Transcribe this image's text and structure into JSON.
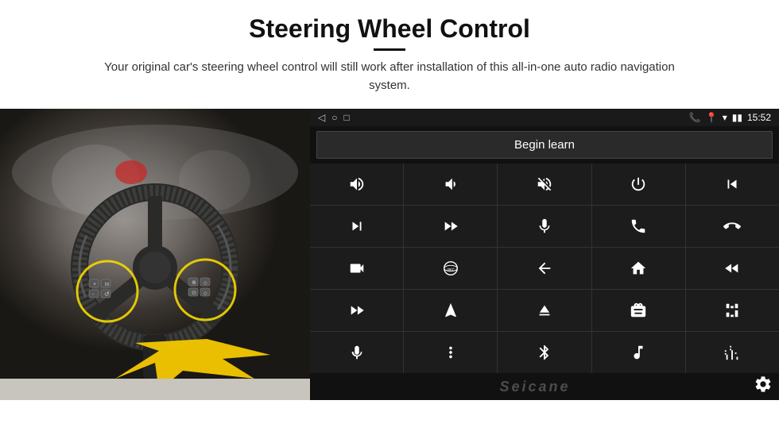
{
  "header": {
    "title": "Steering Wheel Control",
    "subtitle": "Your original car's steering wheel control will still work after installation of this all-in-one auto radio navigation system."
  },
  "statusbar": {
    "time": "15:52",
    "nav_back": "◁",
    "nav_home": "○",
    "nav_recent": "□"
  },
  "begin_learn": {
    "label": "Begin learn"
  },
  "watermark": "Seicane",
  "controls": [
    {
      "icon": "vol-up",
      "row": 0,
      "col": 0
    },
    {
      "icon": "vol-down",
      "row": 0,
      "col": 1
    },
    {
      "icon": "mute",
      "row": 0,
      "col": 2
    },
    {
      "icon": "power",
      "row": 0,
      "col": 3
    },
    {
      "icon": "prev-track",
      "row": 0,
      "col": 4
    },
    {
      "icon": "next",
      "row": 1,
      "col": 0
    },
    {
      "icon": "ff-skip",
      "row": 1,
      "col": 1
    },
    {
      "icon": "mic",
      "row": 1,
      "col": 2
    },
    {
      "icon": "phone",
      "row": 1,
      "col": 3
    },
    {
      "icon": "hangup",
      "row": 1,
      "col": 4
    },
    {
      "icon": "cam",
      "row": 2,
      "col": 0
    },
    {
      "icon": "360",
      "row": 2,
      "col": 1
    },
    {
      "icon": "back",
      "row": 2,
      "col": 2
    },
    {
      "icon": "home",
      "row": 2,
      "col": 3
    },
    {
      "icon": "rw",
      "row": 2,
      "col": 4
    },
    {
      "icon": "ff",
      "row": 3,
      "col": 0
    },
    {
      "icon": "nav",
      "row": 3,
      "col": 1
    },
    {
      "icon": "eject",
      "row": 3,
      "col": 2
    },
    {
      "icon": "radio",
      "row": 3,
      "col": 3
    },
    {
      "icon": "eq",
      "row": 3,
      "col": 4
    },
    {
      "icon": "mic2",
      "row": 4,
      "col": 0
    },
    {
      "icon": "settings2",
      "row": 4,
      "col": 1
    },
    {
      "icon": "bluetooth",
      "row": 4,
      "col": 2
    },
    {
      "icon": "music",
      "row": 4,
      "col": 3
    },
    {
      "icon": "sound",
      "row": 4,
      "col": 4
    }
  ]
}
